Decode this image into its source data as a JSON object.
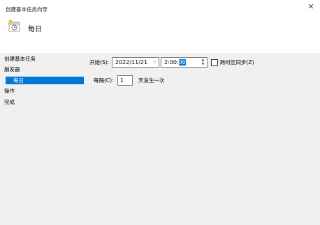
{
  "window": {
    "title": "创建基本任务向导",
    "close_glyph": "✕"
  },
  "header": {
    "icon": "calendar-clock-icon",
    "title": "每日"
  },
  "nav": {
    "items": [
      {
        "label": "创建基本任务",
        "selected": false
      },
      {
        "label": "触发器",
        "selected": false
      },
      {
        "label": "每日",
        "selected": true
      },
      {
        "label": "操作",
        "selected": false
      },
      {
        "label": "完成",
        "selected": false
      }
    ]
  },
  "form": {
    "start_label": "开始(S):",
    "date_value": "2022/11/21",
    "time_prefix": "2:00:",
    "time_selected": "00",
    "sync_label": "跨时区同步(Z)",
    "sync_checked": false,
    "recur_label": "每隔(C):",
    "recur_value": "1",
    "recur_suffix": "天发生一次"
  },
  "colors": {
    "accent": "#0078d7",
    "panel": "#f0f0f0",
    "header": "#ffffff"
  }
}
